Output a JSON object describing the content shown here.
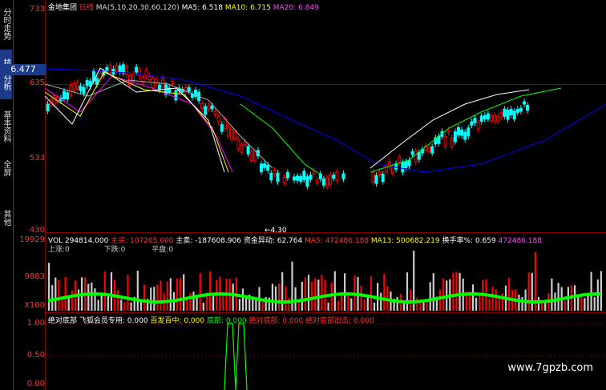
{
  "side_tabs": [
    "分时走势",
    "技术分析",
    "基本资料",
    "全屏",
    "其他"
  ],
  "price_axis": [
    "733",
    "635",
    "533",
    "430"
  ],
  "current_price": "6.477",
  "low_label": "4.30",
  "header": {
    "stock": "金地集团",
    "period": "日线",
    "ma_params": "MA(5,10,20,30,60,120)",
    "ma5": "MA5: 6.518",
    "ma10": "MA10: 6.715",
    "ma20": "MA20: 6.849"
  },
  "vol_header": {
    "vol": "VOL 294814.000",
    "buy_label": "主买: 107205.000",
    "sell": "主卖: -187608.906",
    "capital": "资金异动: 62.764",
    "ma5": "MA5: 472486.188",
    "ma13": "MA13: 500682.219",
    "turnover": "换手率%: 0.659",
    "last": "472486.188"
  },
  "vol_sub": {
    "up": "上涨:0",
    "down": "下跌:0",
    "flat": "平盘:0"
  },
  "vol_axis": [
    "19929",
    "9883",
    "X100"
  ],
  "ind_header": {
    "name": "绝对底部",
    "member": "飞狐会员专用: 0.000",
    "hit": "百发百中: 0.000",
    "bottom": "底部: 0.000",
    "abs_bottom": "绝对底部: 0.000",
    "abs_out": "绝对底部出击: 0.000"
  },
  "ind_axis": [
    "1.00",
    "0.50",
    "0.00"
  ],
  "watermark": "www.7gpzb.com",
  "colors": {
    "ma5": "#ffffff",
    "ma10": "#ffff00",
    "ma20": "#ff00ff",
    "ma30": "#00ff00",
    "ma60": "#aaaaaa",
    "ma120": "#0000ff",
    "up": "#ff0000",
    "down": "#00ff00"
  }
}
